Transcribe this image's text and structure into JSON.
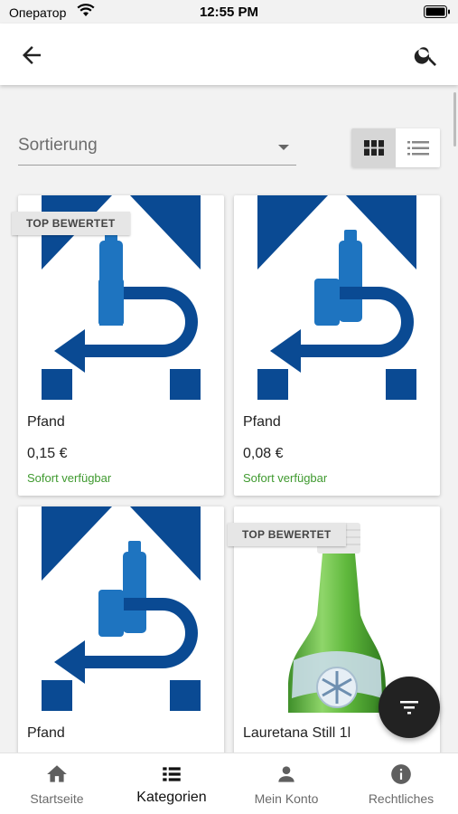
{
  "status_bar": {
    "carrier": "Оператор",
    "time": "12:55 PM"
  },
  "header": {
    "back_icon": "arrow-left-icon",
    "search_icon": "search-icon"
  },
  "sort": {
    "label": "Sortierung"
  },
  "view_toggle": {
    "active": "grid"
  },
  "products": [
    {
      "name": "Pfand",
      "price": "0,15 €",
      "availability": "Sofort verfügbar",
      "badge": "TOP BEWERTET",
      "image": "pfand-logo"
    },
    {
      "name": "Pfand",
      "price": "0,08 €",
      "availability": "Sofort verfügbar",
      "badge": "",
      "image": "pfand-logo"
    },
    {
      "name": "Pfand",
      "price": "",
      "availability": "",
      "badge": "",
      "image": "pfand-logo"
    },
    {
      "name": "Lauretana Still 1l",
      "price": "",
      "availability": "",
      "badge": "TOP BEWERTET",
      "image": "green-bottle"
    }
  ],
  "fab": {
    "icon": "filter-icon"
  },
  "nav": [
    {
      "label": "Startseite",
      "icon": "home-icon",
      "active": false
    },
    {
      "label": "Kategorien",
      "icon": "list-icon",
      "active": true
    },
    {
      "label": "Mein Konto",
      "icon": "person-icon",
      "active": false
    },
    {
      "label": "Rechtliches",
      "icon": "info-icon",
      "active": false
    }
  ],
  "colors": {
    "brand_blue": "#0a4a93",
    "bottle_blue": "#1e74c0",
    "available_green": "#3f9a2f",
    "fab": "#222222"
  }
}
